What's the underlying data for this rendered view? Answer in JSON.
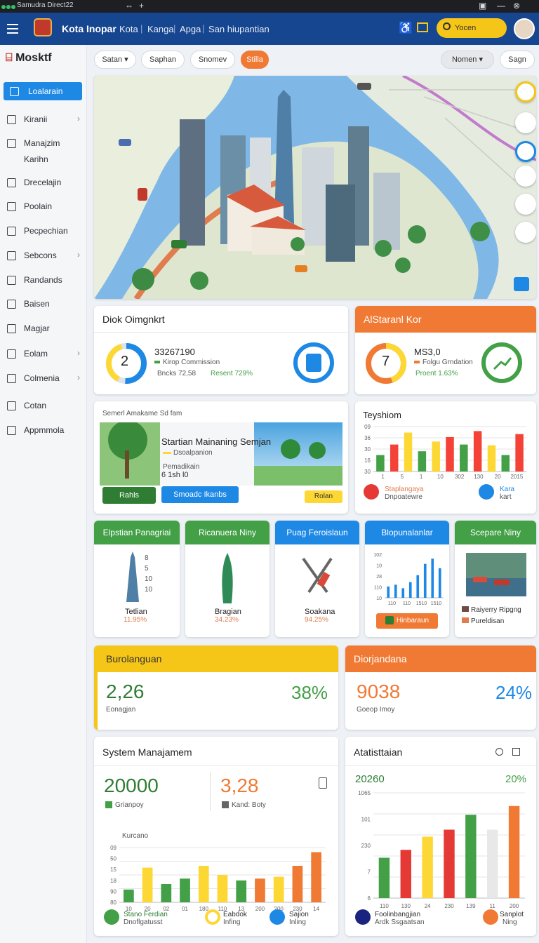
{
  "window": {
    "title": "Samudra Direct22"
  },
  "header": {
    "brand": "Kota Inopar",
    "nav": [
      "Kota",
      "Kanga",
      "Apga",
      "San hiupantian"
    ],
    "search_label": "Yocen"
  },
  "sidebar": {
    "logo": "Mosktf",
    "items": [
      {
        "label": "Loalarain",
        "active": true,
        "chev": false
      },
      {
        "label": "Kiranii",
        "chev": true
      },
      {
        "label": "Manajzim\nKarihn",
        "chev": false
      },
      {
        "label": "Drecelajin",
        "chev": false
      },
      {
        "label": "Poolain",
        "chev": false
      },
      {
        "label": "Pecpechian",
        "chev": false
      },
      {
        "label": "Sebcons",
        "chev": true
      },
      {
        "label": "Randands",
        "chev": false
      },
      {
        "label": "Baisen",
        "chev": false
      },
      {
        "label": "Magjar",
        "chev": false
      },
      {
        "label": "Eolam",
        "chev": true
      },
      {
        "label": "Colmenia",
        "chev": true
      },
      {
        "label": "Cotan",
        "chev": false
      },
      {
        "label": "Appmmola",
        "chev": false
      }
    ]
  },
  "toolbar": {
    "filters": [
      "Satan",
      "Saphan",
      "Snomev",
      "Stilla"
    ],
    "right": [
      "Nomen",
      "Sagn"
    ]
  },
  "card_status": {
    "title": "Diok Oimgnkrt",
    "ring_value": "2",
    "stat_main": "33267190",
    "stat_sub1": "Kirop Commission",
    "stat_sub2": "Bncks 72,58",
    "stat_green": "Resent 729%"
  },
  "card_statusb": {
    "title": "AlStaranl Kor",
    "ring_value": "7",
    "stat_main": "MS3,0",
    "stat_sub1": "Folgu Grndation",
    "stat_sub2": "Proent 1.63%"
  },
  "card_promo": {
    "label": "Semerl Amakame Sd fam",
    "title": "Startian Mainaning Semjan",
    "sub1": "Dsoalpanion",
    "sub2": "Pemadikain",
    "sub3": "6 1sh l0",
    "btn_left": "Rahls",
    "btn_blue": "Smoadc Ikanbs",
    "btn_yellow": "Rolan"
  },
  "card_teyshiom": {
    "title": "Teyshiom",
    "y_ticks": [
      "09",
      "36",
      "30",
      "16",
      "30"
    ],
    "x_ticks": [
      "1",
      "5",
      "1",
      "10",
      "302",
      "130",
      "20",
      "2015"
    ],
    "legend": [
      {
        "label": "Staplangaya",
        "sub": "Dnpoatewre"
      },
      {
        "label": "Kara",
        "sub": "kart"
      }
    ]
  },
  "chart_data": [
    {
      "type": "bar",
      "series_colors": [
        "#43a047",
        "#f44336",
        "#fdd835",
        "#43a047",
        "#fdd835",
        "#f44336",
        "#43a047",
        "#f44336",
        "#fdd835",
        "#43a047",
        "#f44336"
      ],
      "values": [
        22,
        36,
        52,
        27,
        40,
        46,
        36,
        54,
        35,
        22,
        50
      ],
      "ylim": [
        0,
        60
      ]
    },
    {
      "type": "bar",
      "x_ticks": [
        "110",
        "110",
        "1510",
        "1510"
      ],
      "y_ticks": [
        "102",
        "10",
        "28",
        "110",
        "10"
      ],
      "values": [
        26,
        30,
        22,
        36,
        52,
        78,
        90,
        68
      ],
      "ylim": [
        0,
        100
      ]
    },
    {
      "type": "bar",
      "x": [
        "10",
        "20",
        "02",
        "01",
        "180",
        "110",
        "13",
        "200",
        "200",
        "230",
        "14"
      ],
      "y_ticks": [
        "09",
        "50",
        "15",
        "18",
        "90",
        "80"
      ],
      "ylabel": "Kurcano",
      "values": [
        14,
        38,
        20,
        26,
        40,
        30,
        24,
        26,
        28,
        40,
        55
      ],
      "ylim": [
        0,
        60
      ]
    },
    {
      "type": "bar",
      "x": [
        "110",
        "130",
        "24",
        "230",
        "139",
        "11",
        "200"
      ],
      "y_ticks": [
        "1065",
        "101",
        "230",
        "7",
        "6"
      ],
      "values": [
        46,
        55,
        70,
        78,
        95,
        78,
        105
      ],
      "ylim": [
        0,
        120
      ]
    }
  ],
  "tiles": [
    {
      "title": "Elpstian Panagriai",
      "label": "Tetlian",
      "value": "11.95%",
      "axis": [
        "8",
        "5",
        "10",
        "10"
      ]
    },
    {
      "title": "Ricanuera Niny",
      "label": "Bragian",
      "value": "34.23%"
    },
    {
      "title": "Puag Feroislaun",
      "label": "Soakana",
      "value": "94.25%"
    },
    {
      "title": "Blopunalanlar",
      "btn": "Hinbaraun"
    },
    {
      "title": "Scepare Niny",
      "items": [
        "Raiyerry Ripgng",
        "Pureldisan"
      ]
    }
  ],
  "kpi_yellow": {
    "title": "Burolanguan",
    "value": "2,26",
    "sub": "Eonagjan",
    "pct": "38%"
  },
  "kpi_orange": {
    "title": "Diorjandana",
    "value": "9038",
    "sub": "Goeop Imoy",
    "pct": "24%"
  },
  "system": {
    "title": "System Manajamem",
    "big1": "20000",
    "lab1": "Grianpoy",
    "big2": "3,28",
    "lab2": "Kand: Boty",
    "legend": [
      {
        "label": "Stano Ferdian",
        "sub": "Dnoflgatusst"
      },
      {
        "label": "Eabdok",
        "sub": "Infing"
      },
      {
        "label": "Sajion",
        "sub": "Inling"
      }
    ]
  },
  "stats": {
    "title": "Atatisttaian",
    "left_val": "20260",
    "right_pct": "20%",
    "legend": [
      {
        "label": "Foolinbangjian",
        "sub": "Ardk Ssgaatsan"
      },
      {
        "label": "Sanplot",
        "sub": "Ning"
      }
    ]
  },
  "colors": {
    "header": "#164690",
    "blue": "#1e88e5",
    "green": "#43a047",
    "orange": "#f07a34",
    "yellow": "#f5c518",
    "red": "#e53935"
  }
}
